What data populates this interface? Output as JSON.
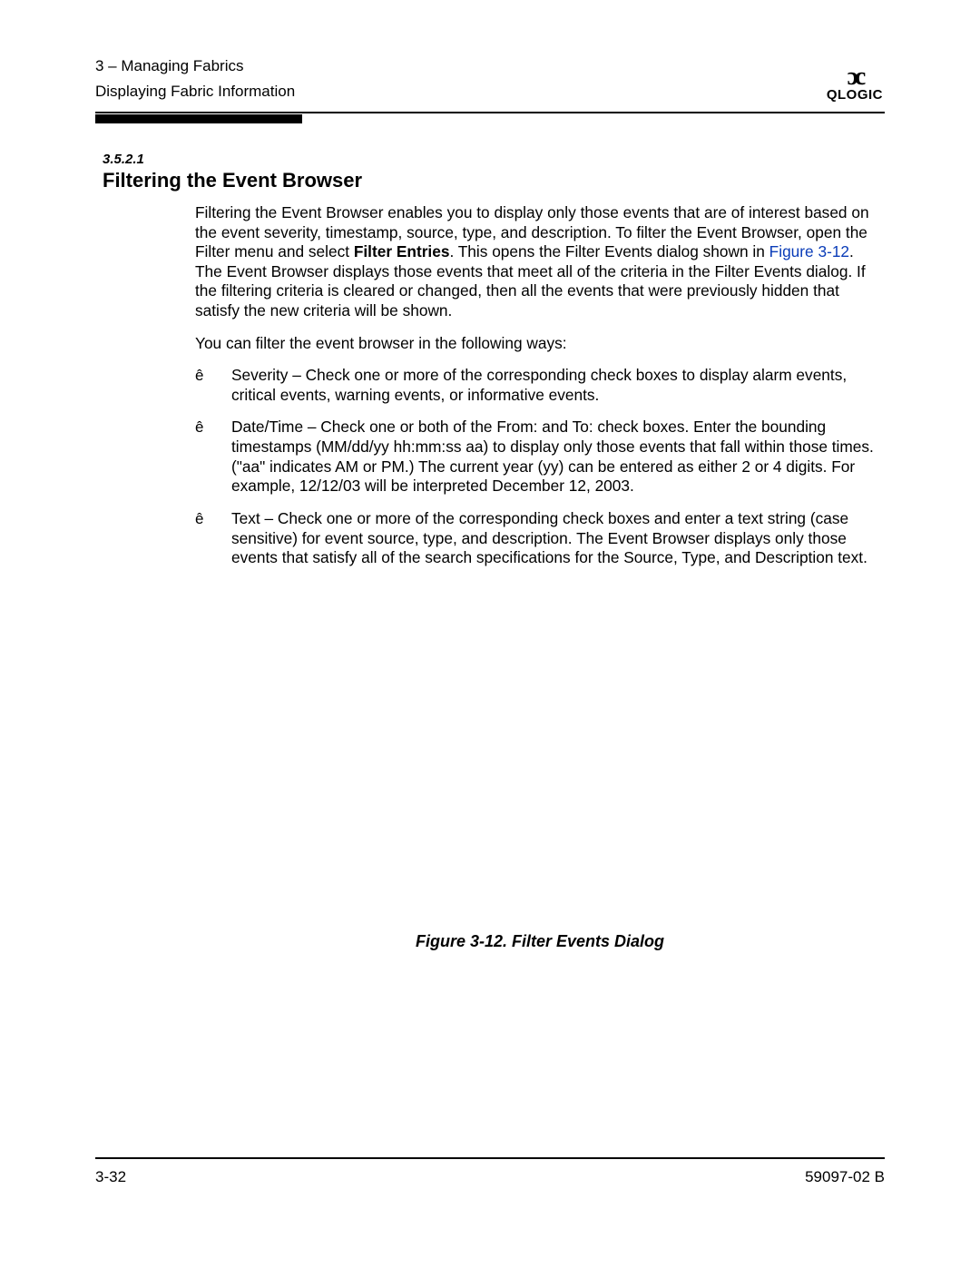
{
  "header": {
    "chapter_line": "3 – Managing Fabrics",
    "section_line": "Displaying Fabric Information"
  },
  "logo": {
    "icon": "ɔc",
    "text": "QLOGIC"
  },
  "section": {
    "number": "3.5.2.1",
    "title": "Filtering the Event Browser"
  },
  "para1": {
    "a": "Filtering the Event Browser enables you to display only those events that are of interest based on the event severity, timestamp, source, type, and description. To filter the Event Browser, open the Filter menu and select ",
    "bold": "Filter Entries",
    "b": ". This opens the Filter Events dialog shown in ",
    "link": "Figure 3-12",
    "c": ". The Event Browser displays those events that meet all of the criteria in the Filter Events dialog. If the filtering criteria is cleared or changed, then all the events that were previously hidden that satisfy the new criteria will be shown."
  },
  "para2": "You can filter the event browser in the following ways:",
  "bullet_char": "ê",
  "bullets": [
    "Severity – Check one or more of the corresponding check boxes to display alarm events, critical events, warning events, or informative events.",
    "Date/Time – Check one or both of the From: and To: check boxes. Enter the bounding timestamps (MM/dd/yy hh:mm:ss aa) to display only those events that fall within those times. (\"aa\" indicates AM or PM.) The current year (yy) can be entered as either 2 or 4 digits. For example, 12/12/03 will be interpreted December 12, 2003.",
    "Text – Check one or more of the corresponding check boxes and enter a text string (case sensitive) for event source, type, and description. The Event Browser displays only those events that satisfy all of the search specifications for the Source, Type, and Description text."
  ],
  "figure_caption": "Figure 3-12.  Filter Events Dialog",
  "footer": {
    "page": "3-32",
    "docid": "59097-02 B"
  }
}
